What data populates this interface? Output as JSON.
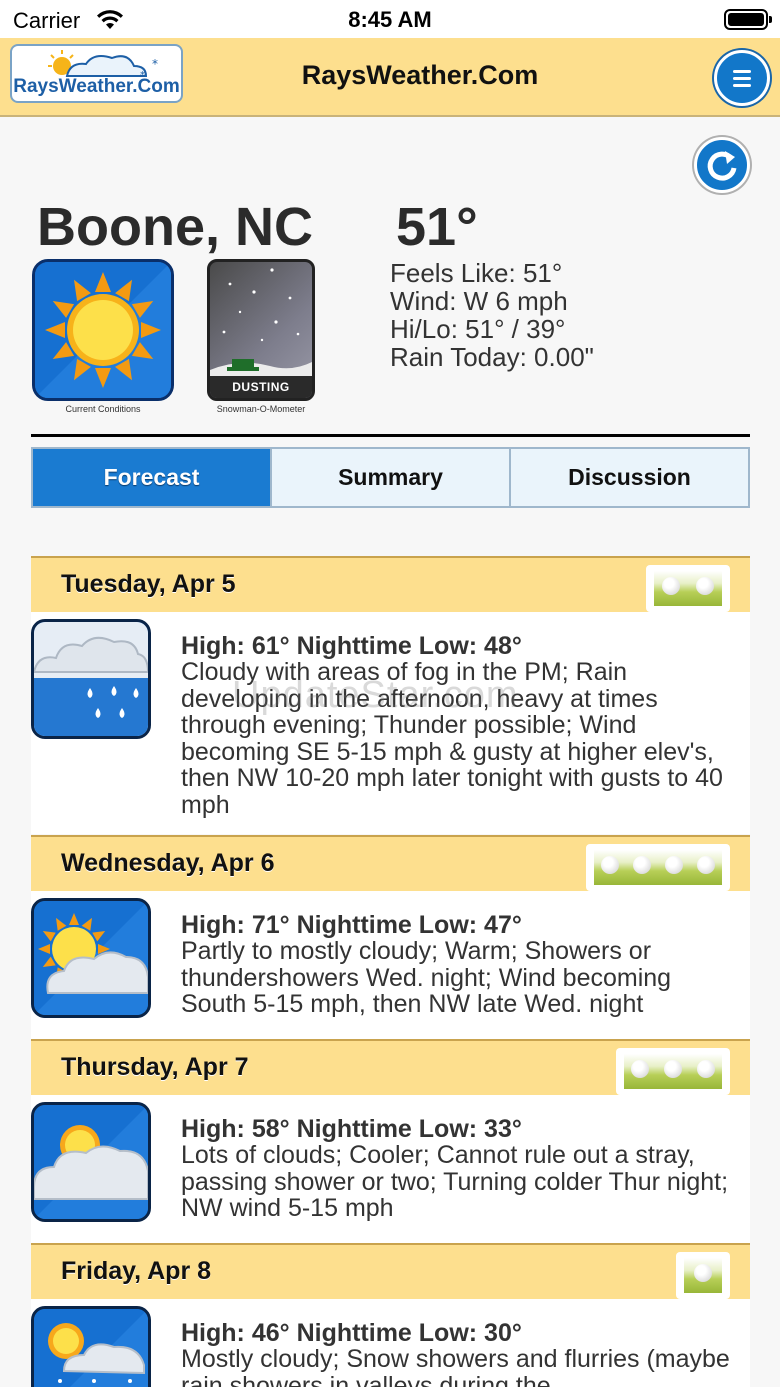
{
  "status_bar": {
    "carrier": "Carrier",
    "time": "8:45 AM"
  },
  "header": {
    "logo_text": "RaysWeather.Com",
    "title": "RaysWeather.Com"
  },
  "current": {
    "city": "Boone, NC",
    "temperature": "51°",
    "feels_like": "Feels Like: 51°",
    "wind": "Wind: W 6 mph",
    "hi_lo": "Hi/Lo: 51° / 39°",
    "rain_today": "Rain Today: 0.00\"",
    "conditions_label": "Current Conditions",
    "snowman_label": "Snowman-O-Mometer",
    "snowman_status": "DUSTING"
  },
  "tabs": [
    {
      "label": "Forecast",
      "active": true
    },
    {
      "label": "Summary",
      "active": false
    },
    {
      "label": "Discussion",
      "active": false
    }
  ],
  "watermark": "UpdateStar.com",
  "forecast": [
    {
      "day": "Tuesday, Apr 5",
      "golf_rating": 2,
      "icon": "rain-cloud-icon",
      "hilo": "High: 61° Nighttime Low: 48°",
      "desc": "Cloudy with areas of fog in the PM; Rain developing in the afternoon, heavy at times through evening; Thunder possible; Wind becoming SE 5-15 mph & gusty at higher elev's, then NW 10-20 mph later tonight with gusts to 40 mph"
    },
    {
      "day": "Wednesday, Apr 6",
      "golf_rating": 4,
      "icon": "partly-cloudy-icon",
      "hilo": "High: 71° Nighttime Low: 47°",
      "desc": "Partly to mostly cloudy; Warm; Showers or thundershowers Wed. night; Wind becoming South 5-15 mph, then NW late Wed. night"
    },
    {
      "day": "Thursday, Apr 7",
      "golf_rating": 3,
      "icon": "mostly-cloudy-icon",
      "hilo": "High: 58° Nighttime Low: 33°",
      "desc": "Lots of clouds; Cooler; Cannot rule out a stray, passing shower or two; Turning colder Thur night; NW wind 5-15 mph"
    },
    {
      "day": "Friday, Apr 8",
      "golf_rating": 1,
      "icon": "snow-showers-icon",
      "hilo": "High: 46° Nighttime Low: 30°",
      "desc": "Mostly cloudy; Snow showers and flurries (maybe rain showers in valleys during the"
    }
  ]
}
